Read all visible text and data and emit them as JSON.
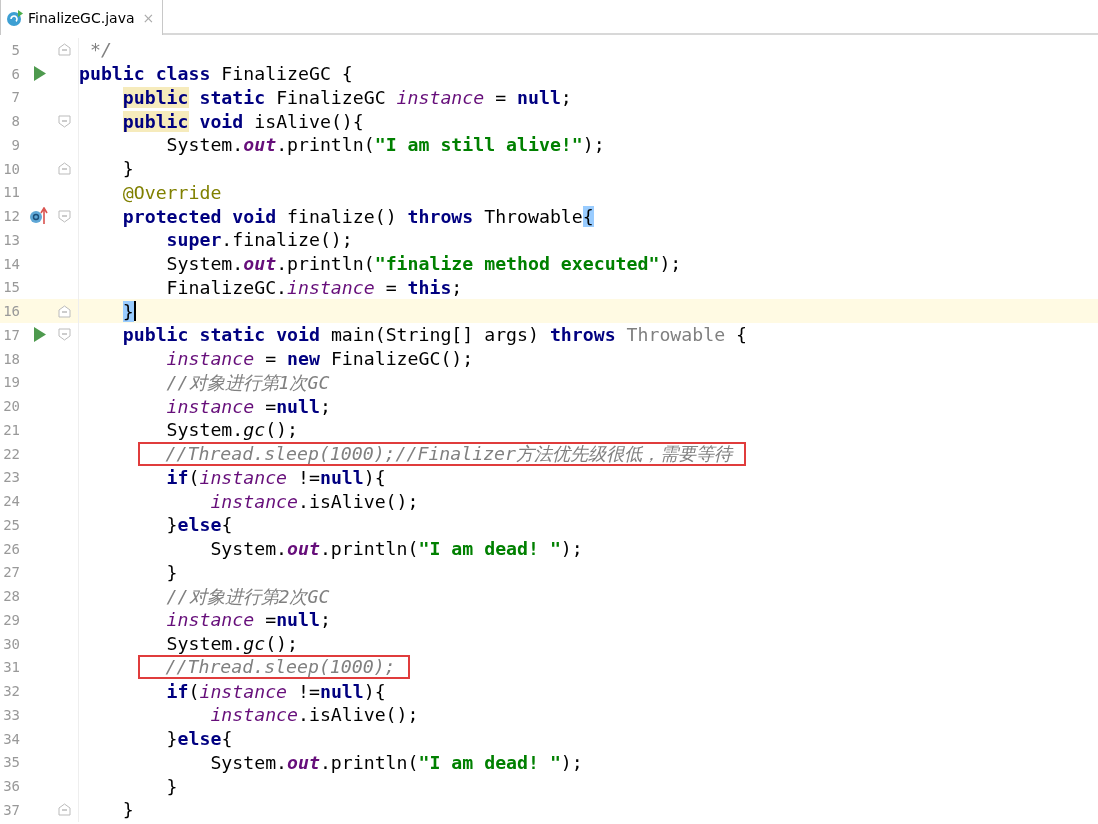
{
  "tabs": [
    {
      "label": "FinalizeGC.java",
      "close": "×",
      "selected": true
    }
  ],
  "lines": [
    {
      "number": "5",
      "gutter": [
        {
          "kind": "fold-end"
        }
      ],
      "tokens": [
        {
          "kind": "comment",
          "text": " */"
        }
      ]
    },
    {
      "number": "6",
      "gutter": [
        {
          "kind": "run"
        }
      ],
      "tokens": [
        {
          "kind": "keyword",
          "text": "public"
        },
        {
          "kind": "keyword",
          "text": " class"
        },
        {
          "kind": "plain",
          "text": " FinalizeGC {"
        }
      ]
    },
    {
      "number": "7",
      "tokens": [
        {
          "kind": "keyword",
          "text": "    public",
          "highlight": true
        },
        {
          "kind": "keyword",
          "text": " static"
        },
        {
          "kind": "plain",
          "text": " FinalizeGC "
        },
        {
          "kind": "field",
          "text": "instance"
        },
        {
          "kind": "plain",
          "text": " = "
        },
        {
          "kind": "keyword",
          "text": "null"
        },
        {
          "kind": "plain",
          "text": ";"
        }
      ]
    },
    {
      "number": "8",
      "gutter": [
        {
          "kind": "fold-start"
        }
      ],
      "tokens": [
        {
          "kind": "keyword",
          "text": "    public",
          "highlight": true
        },
        {
          "kind": "keyword",
          "text": " void"
        },
        {
          "kind": "plain",
          "text": " isAlive(){"
        }
      ]
    },
    {
      "number": "9",
      "tokens": [
        {
          "kind": "plain",
          "text": "        System."
        },
        {
          "kind": "static",
          "text": "out"
        },
        {
          "kind": "plain",
          "text": ".println("
        },
        {
          "kind": "string",
          "text": "\"I am still alive!\""
        },
        {
          "kind": "plain",
          "text": ");"
        }
      ]
    },
    {
      "number": "10",
      "gutter": [
        {
          "kind": "fold-end"
        }
      ],
      "tokens": [
        {
          "kind": "plain",
          "text": "    }"
        }
      ]
    },
    {
      "number": "11",
      "tokens": [
        {
          "kind": "annotation",
          "text": "    @Override"
        }
      ]
    },
    {
      "number": "12",
      "gutter": [
        {
          "kind": "override"
        },
        {
          "kind": "fold-start"
        }
      ],
      "tokens": [
        {
          "kind": "keyword",
          "text": "    protected"
        },
        {
          "kind": "keyword",
          "text": " void"
        },
        {
          "kind": "plain",
          "text": " finalize() "
        },
        {
          "kind": "keyword",
          "text": "throws"
        },
        {
          "kind": "plain",
          "text": " Throwable"
        },
        {
          "kind": "brace",
          "text": "{"
        }
      ]
    },
    {
      "number": "13",
      "tokens": [
        {
          "kind": "keyword",
          "text": "        super"
        },
        {
          "kind": "plain",
          "text": ".finalize();"
        }
      ]
    },
    {
      "number": "14",
      "tokens": [
        {
          "kind": "plain",
          "text": "        System."
        },
        {
          "kind": "static",
          "text": "out"
        },
        {
          "kind": "plain",
          "text": ".println("
        },
        {
          "kind": "string",
          "text": "\"finalize method executed\""
        },
        {
          "kind": "plain",
          "text": ");"
        }
      ]
    },
    {
      "number": "15",
      "tokens": [
        {
          "kind": "plain",
          "text": "        FinalizeGC."
        },
        {
          "kind": "field",
          "text": "instance"
        },
        {
          "kind": "plain",
          "text": " = "
        },
        {
          "kind": "keyword",
          "text": "this"
        },
        {
          "kind": "plain",
          "text": ";"
        }
      ]
    },
    {
      "number": "16",
      "gutter": [
        {
          "kind": "fold-end"
        }
      ],
      "current": true,
      "tokens": [
        {
          "kind": "brace",
          "text": "    }"
        }
      ]
    },
    {
      "number": "17",
      "gutter": [
        {
          "kind": "run"
        },
        {
          "kind": "fold-start"
        }
      ],
      "tokens": [
        {
          "kind": "keyword",
          "text": "    public"
        },
        {
          "kind": "keyword",
          "text": " static"
        },
        {
          "kind": "keyword",
          "text": " void"
        },
        {
          "kind": "plain",
          "text": " main(String[] args) "
        },
        {
          "kind": "keyword",
          "text": "throws"
        },
        {
          "kind": "unused",
          "text": " Throwable"
        },
        {
          "kind": "plain",
          "text": " {"
        }
      ]
    },
    {
      "number": "18",
      "tokens": [
        {
          "kind": "field",
          "text": "        instance"
        },
        {
          "kind": "plain",
          "text": " = "
        },
        {
          "kind": "keyword",
          "text": "new"
        },
        {
          "kind": "plain",
          "text": " FinalizeGC();"
        }
      ]
    },
    {
      "number": "19",
      "tokens": [
        {
          "kind": "comment",
          "text": "        //对象进行第1次GC"
        }
      ]
    },
    {
      "number": "20",
      "tokens": [
        {
          "kind": "field",
          "text": "        instance"
        },
        {
          "kind": "plain",
          "text": " ="
        },
        {
          "kind": "keyword",
          "text": "null"
        },
        {
          "kind": "plain",
          "text": ";"
        }
      ]
    },
    {
      "number": "21",
      "tokens": [
        {
          "kind": "plain",
          "text": "        System."
        },
        {
          "kind": "method",
          "text": "gc"
        },
        {
          "kind": "plain",
          "text": "();"
        }
      ]
    },
    {
      "number": "22",
      "marked": true,
      "tokens": [
        {
          "kind": "comment",
          "text": "        //Thread.sleep(1000);//Finalizer方法优先级很低，需要等待"
        }
      ]
    },
    {
      "number": "23",
      "tokens": [
        {
          "kind": "keyword",
          "text": "        if"
        },
        {
          "kind": "plain",
          "text": "("
        },
        {
          "kind": "field",
          "text": "instance"
        },
        {
          "kind": "plain",
          "text": " !="
        },
        {
          "kind": "keyword",
          "text": "null"
        },
        {
          "kind": "plain",
          "text": "){"
        }
      ]
    },
    {
      "number": "24",
      "tokens": [
        {
          "kind": "field",
          "text": "            instance"
        },
        {
          "kind": "plain",
          "text": ".isAlive();"
        }
      ]
    },
    {
      "number": "25",
      "tokens": [
        {
          "kind": "plain",
          "text": "        }"
        },
        {
          "kind": "keyword",
          "text": "else"
        },
        {
          "kind": "plain",
          "text": "{"
        }
      ]
    },
    {
      "number": "26",
      "tokens": [
        {
          "kind": "plain",
          "text": "            System."
        },
        {
          "kind": "static",
          "text": "out"
        },
        {
          "kind": "plain",
          "text": ".println("
        },
        {
          "kind": "string",
          "text": "\"I am dead! \""
        },
        {
          "kind": "plain",
          "text": ");"
        }
      ]
    },
    {
      "number": "27",
      "tokens": [
        {
          "kind": "plain",
          "text": "        }"
        }
      ]
    },
    {
      "number": "28",
      "tokens": [
        {
          "kind": "comment",
          "text": "        //对象进行第2次GC"
        }
      ]
    },
    {
      "number": "29",
      "tokens": [
        {
          "kind": "field",
          "text": "        instance"
        },
        {
          "kind": "plain",
          "text": " ="
        },
        {
          "kind": "keyword",
          "text": "null"
        },
        {
          "kind": "plain",
          "text": ";"
        }
      ]
    },
    {
      "number": "30",
      "tokens": [
        {
          "kind": "plain",
          "text": "        System."
        },
        {
          "kind": "method",
          "text": "gc"
        },
        {
          "kind": "plain",
          "text": "();"
        }
      ]
    },
    {
      "number": "31",
      "marked": true,
      "tokens": [
        {
          "kind": "comment",
          "text": "        //Thread.sleep(1000);"
        }
      ]
    },
    {
      "number": "32",
      "tokens": [
        {
          "kind": "keyword",
          "text": "        if"
        },
        {
          "kind": "plain",
          "text": "("
        },
        {
          "kind": "field",
          "text": "instance"
        },
        {
          "kind": "plain",
          "text": " !="
        },
        {
          "kind": "keyword",
          "text": "null"
        },
        {
          "kind": "plain",
          "text": "){"
        }
      ]
    },
    {
      "number": "33",
      "tokens": [
        {
          "kind": "field",
          "text": "            instance"
        },
        {
          "kind": "plain",
          "text": ".isAlive();"
        }
      ]
    },
    {
      "number": "34",
      "tokens": [
        {
          "kind": "plain",
          "text": "        }"
        },
        {
          "kind": "keyword",
          "text": "else"
        },
        {
          "kind": "plain",
          "text": "{"
        }
      ]
    },
    {
      "number": "35",
      "tokens": [
        {
          "kind": "plain",
          "text": "            System."
        },
        {
          "kind": "static",
          "text": "out"
        },
        {
          "kind": "plain",
          "text": ".println("
        },
        {
          "kind": "string",
          "text": "\"I am dead! \""
        },
        {
          "kind": "plain",
          "text": ");"
        }
      ]
    },
    {
      "number": "36",
      "tokens": [
        {
          "kind": "plain",
          "text": "        }"
        }
      ]
    },
    {
      "number": "37",
      "gutter": [
        {
          "kind": "fold-end"
        }
      ],
      "tokens": [
        {
          "kind": "plain",
          "text": "    }"
        }
      ]
    }
  ]
}
